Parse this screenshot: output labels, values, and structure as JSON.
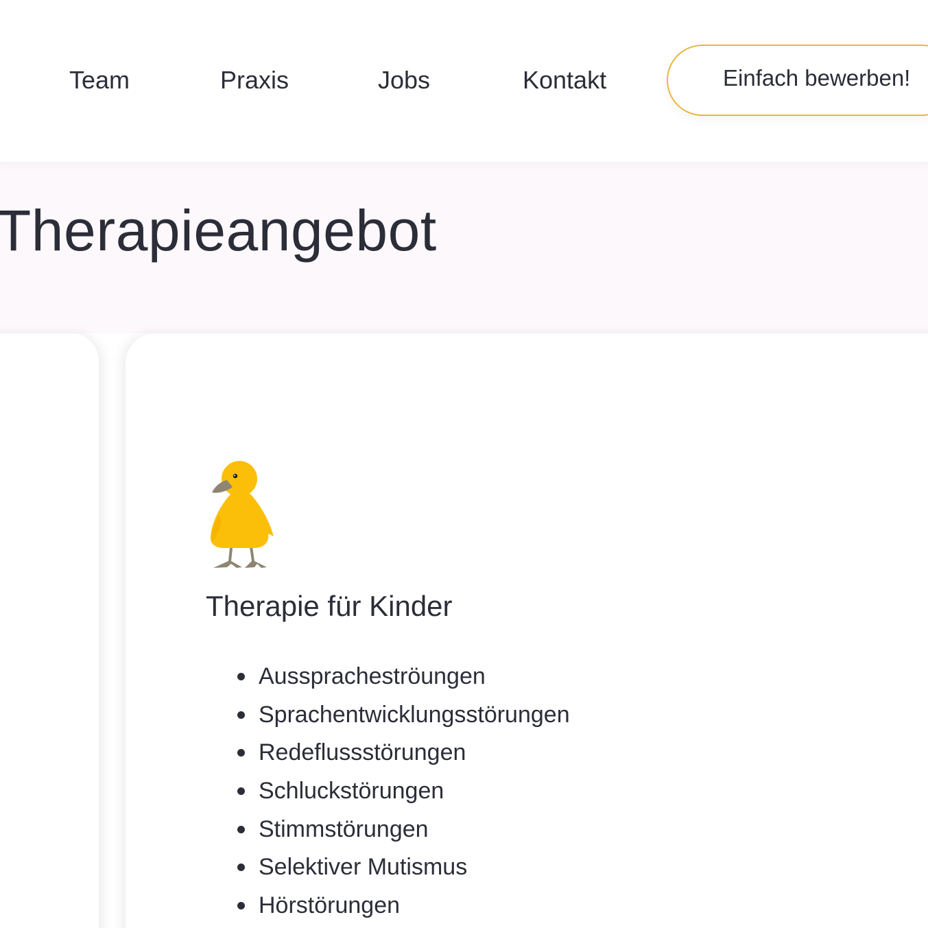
{
  "nav": {
    "items": [
      {
        "label": "Team"
      },
      {
        "label": "Praxis"
      },
      {
        "label": "Jobs"
      },
      {
        "label": "Kontakt"
      }
    ],
    "cta_label": "Einfach bewerben!"
  },
  "hero": {
    "title": "Therapieangebot"
  },
  "section": {
    "icon": "duckling-icon",
    "title": "Therapie für Kinder",
    "items": [
      {
        "label": "Ausspracheströungen"
      },
      {
        "label": "Sprachentwicklungsstörungen"
      },
      {
        "label": "Redeflussstörungen"
      },
      {
        "label": "Schluckstörungen"
      },
      {
        "label": "Stimmstörungen"
      },
      {
        "label": "Selektiver Mutismus"
      },
      {
        "label": "Hörstörungen"
      }
    ]
  },
  "colors": {
    "accent": "#e9b83a",
    "duck_body": "#fbbf0a",
    "duck_beak": "#8e8572",
    "text": "#2b2d38",
    "hero_background": "#fdf8fb"
  }
}
